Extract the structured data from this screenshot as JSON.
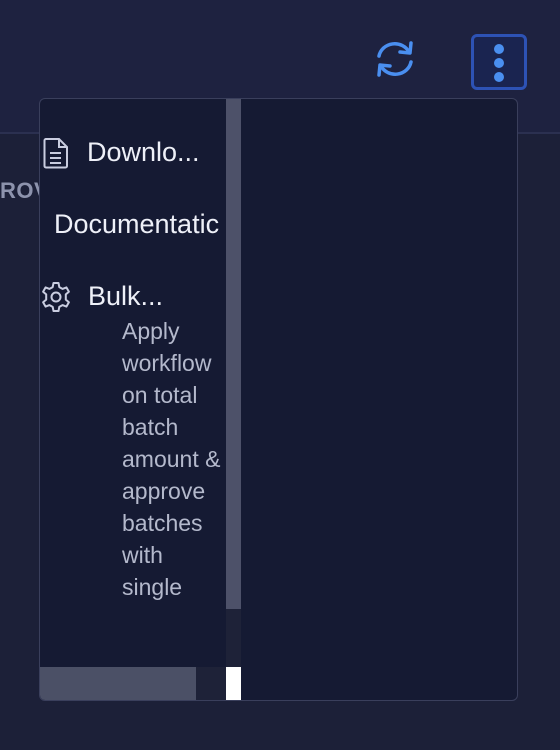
{
  "background": {
    "column_label": "ROV"
  },
  "header": {
    "refresh_icon": "refresh-icon",
    "more_icon": "kebab-menu-icon",
    "accent_color": "#4a8ff0"
  },
  "dropdown": {
    "items": [
      {
        "icon": "document-icon",
        "label": "Downlo..."
      },
      {
        "icon": "",
        "label": "Documentatic"
      },
      {
        "icon": "gear-icon",
        "label": "Bulk...",
        "description": "Apply workflow on total batch amount & approve batches with single"
      }
    ]
  }
}
